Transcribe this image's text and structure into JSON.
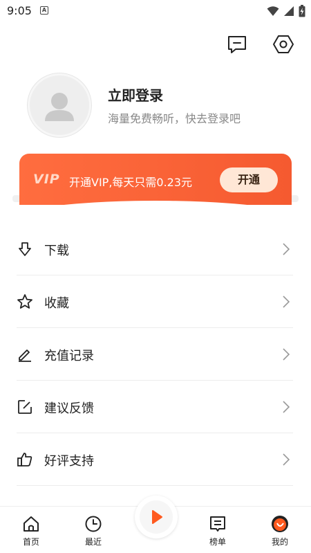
{
  "status_bar": {
    "time": "9:05"
  },
  "header": {
    "message_icon": "message-icon",
    "settings_icon": "settings-icon"
  },
  "profile": {
    "title": "立即登录",
    "subtitle": "海量免费畅听，快去登录吧"
  },
  "vip": {
    "logo": "VIP",
    "text": "开通VIP,每天只需0.23元",
    "button": "开通",
    "color": "#f55a30"
  },
  "menu": {
    "items": [
      {
        "label": "下载",
        "icon": "download-icon"
      },
      {
        "label": "收藏",
        "icon": "star-icon"
      },
      {
        "label": "充值记录",
        "icon": "pencil-icon"
      },
      {
        "label": "建议反馈",
        "icon": "edit-square-icon"
      },
      {
        "label": "好评支持",
        "icon": "thumbs-up-icon"
      }
    ]
  },
  "tabbar": {
    "items": [
      {
        "label": "首页",
        "icon": "home-icon"
      },
      {
        "label": "最近",
        "icon": "clock-icon"
      },
      {
        "label": "",
        "icon": "play-icon"
      },
      {
        "label": "榜单",
        "icon": "chart-list-icon"
      },
      {
        "label": "我的",
        "icon": "profile-icon"
      }
    ],
    "active": "我的",
    "accent": "#ff5a1f"
  }
}
